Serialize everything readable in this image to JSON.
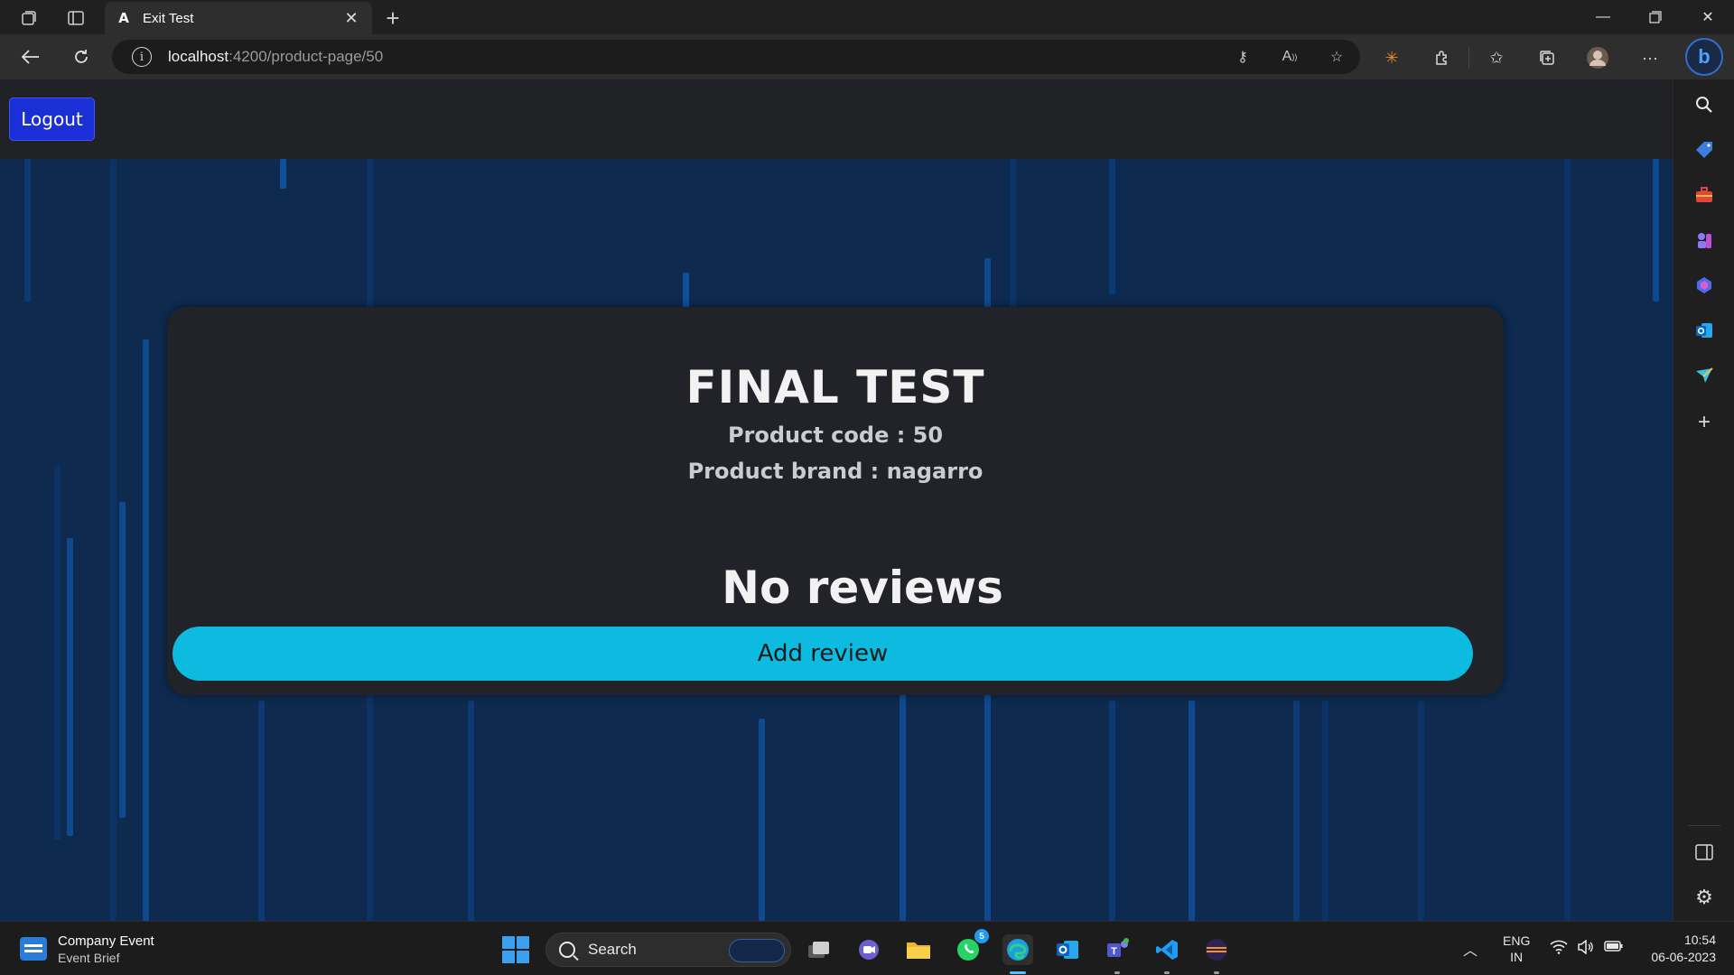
{
  "browser": {
    "tab": {
      "title": "Exit Test",
      "favicon": "A"
    },
    "url": {
      "host": "localhost",
      "path": ":4200/product-page/50"
    }
  },
  "page": {
    "logout_label": "Logout",
    "product": {
      "name": "FINAL TEST",
      "code_text": "Product code : 50",
      "brand_text": "Product brand : nagarro"
    },
    "reviews": {
      "empty_text": "No reviews",
      "add_label": "Add review"
    }
  },
  "taskbar": {
    "widget": {
      "title": "Company Event",
      "subtitle": "Event Brief"
    },
    "search_label": "Search",
    "whatsapp_badge": "5",
    "language": {
      "line1": "ENG",
      "line2": "IN"
    },
    "clock": {
      "time": "10:54",
      "date": "06-06-2023"
    }
  },
  "colors": {
    "page_background": "#0e2a4e",
    "card_background": "#212329",
    "add_review_button": "#0dbae0",
    "logout_button": "#1b2fd6"
  }
}
